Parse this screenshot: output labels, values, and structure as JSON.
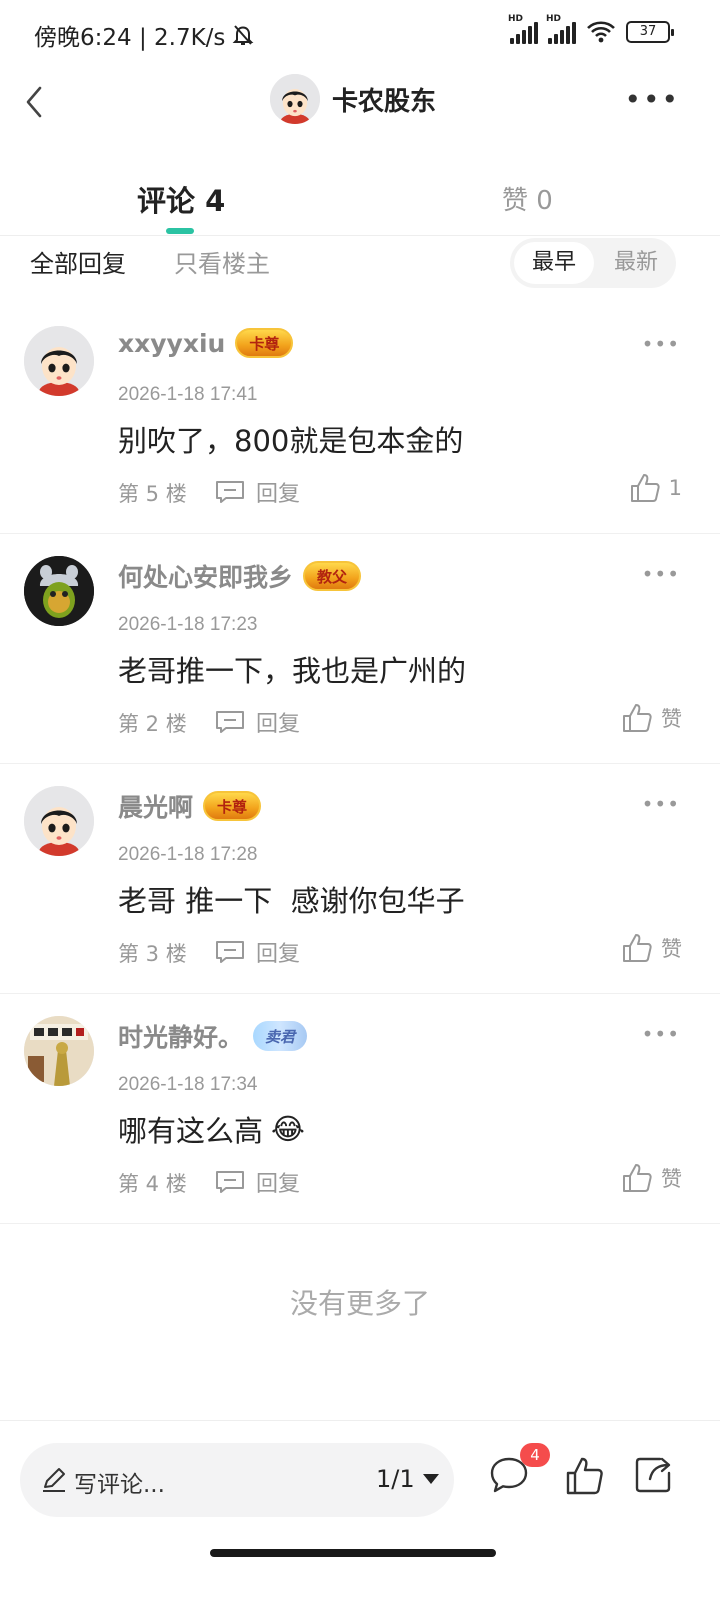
{
  "status_bar": {
    "time_speed": "傍晚6:24 | 2.7K/s",
    "battery": "37",
    "hd_label": "HD",
    "icons": [
      "mute-bell-icon",
      "signal-icon",
      "wifi-icon",
      "battery-icon"
    ]
  },
  "header": {
    "title": "卡农股东",
    "icons": [
      "back-arrow-icon",
      "avatar",
      "more-dots-icon"
    ]
  },
  "tabs": {
    "comments": "评论 4",
    "likes": "赞 0",
    "active": "comments",
    "accent": "#2bc3a3"
  },
  "filters": {
    "all": "全部回复",
    "host_only": "只看楼主",
    "sort_earliest": "最早",
    "sort_latest": "最新",
    "active_sort": "最早"
  },
  "comments": [
    {
      "name": "xxyyxiu",
      "badge": "卡尊",
      "time": "2026-1-18 17:41",
      "text": "别吹了，800就是包本金的",
      "floor": "第 5 楼",
      "reply": "回复",
      "likes": "1"
    },
    {
      "name": "何处心安即我乡",
      "badge": "教父",
      "time": "2026-1-18 17:23",
      "text": "老哥推一下，我也是广州的",
      "floor": "第 2 楼",
      "reply": "回复",
      "likes": "赞"
    },
    {
      "name": "晨光啊",
      "badge": "卡尊",
      "time": "2026-1-18 17:28",
      "text": "老哥 推一下  感谢你包华子",
      "floor": "第 3 楼",
      "reply": "回复",
      "likes": "赞"
    },
    {
      "name": "时光静好。",
      "badge": "卖君",
      "time": "2026-1-18 17:34",
      "text": "哪有这么高",
      "emoji": "😂",
      "floor": "第 4 楼",
      "reply": "回复",
      "likes": "赞"
    }
  ],
  "footer_text": "没有更多了",
  "bottom_bar": {
    "write_label": "写评论...",
    "page": "1/1",
    "comment_count": "4",
    "badge_color": "#f54c4c"
  }
}
